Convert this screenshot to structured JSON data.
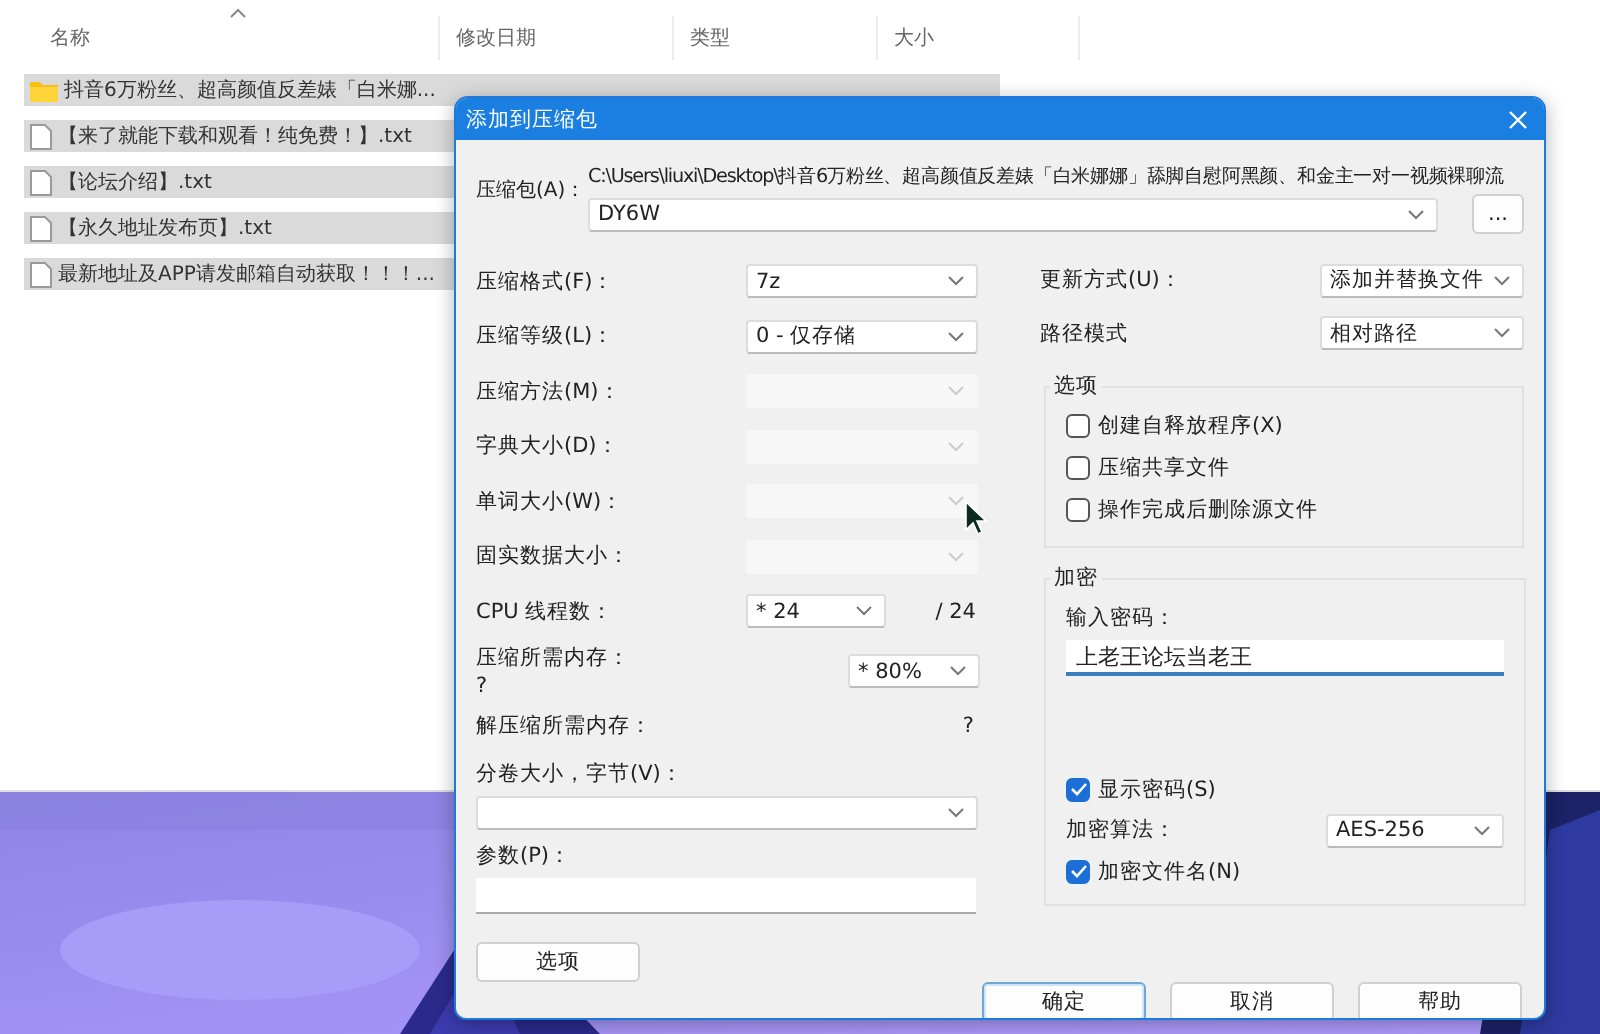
{
  "explorer": {
    "columns": [
      {
        "label": "名称",
        "sorted": true
      },
      {
        "label": "修改日期",
        "sorted": false
      },
      {
        "label": "类型",
        "sorted": false
      },
      {
        "label": "大小",
        "sorted": false
      }
    ],
    "rows": [
      {
        "kind": "folder",
        "name": "抖音6万粉丝、超高颜值反差婊「白米娜...",
        "selected": true
      },
      {
        "kind": "text-file",
        "name": "【来了就能下载和观看！纯免费！】.txt",
        "selected": true
      },
      {
        "kind": "text-file",
        "name": "【论坛介绍】.txt",
        "selected": true
      },
      {
        "kind": "text-file",
        "name": "【永久地址发布页】.txt",
        "selected": true
      },
      {
        "kind": "text-file",
        "name": "最新地址及APP请发邮箱自动获取！！！...",
        "selected": true
      }
    ]
  },
  "dialog": {
    "title": "添加到压缩包",
    "archive": {
      "label": "压缩包(A)：",
      "path": "C:\\Users\\liuxi\\Desktop\\抖音6万粉丝、超高颜值反差婊「白米娜娜」舔脚自慰阿黑颜、和金主一对一视频裸聊流",
      "value": "DY6W"
    },
    "browse_button": "...",
    "left_fields": [
      {
        "kind": "select",
        "label": "压缩格式(F)：",
        "value": "7z",
        "disabled": false
      },
      {
        "kind": "select",
        "label": "压缩等级(L)：",
        "value": "0 - 仅存储",
        "disabled": false
      },
      {
        "kind": "select",
        "label": "压缩方法(M)：",
        "disabled": true
      },
      {
        "kind": "select",
        "label": "字典大小(D)：",
        "disabled": true
      },
      {
        "kind": "select",
        "label": "单词大小(W)：",
        "disabled": true
      },
      {
        "kind": "select",
        "label": "固实数据大小：",
        "disabled": true
      },
      {
        "kind": "threads",
        "label": "CPU 线程数：",
        "value": "* 24",
        "suffix": "/ 24"
      },
      {
        "kind": "memory",
        "label": "压缩所需内存：",
        "note": "?",
        "value": "* 80%"
      },
      {
        "kind": "info",
        "label": "解压缩所需内存：",
        "note": "?"
      },
      {
        "kind": "stacked-select",
        "label": "分卷大小，字节(V)："
      },
      {
        "kind": "stacked-input",
        "label": "参数(P)："
      }
    ],
    "options_button": "选项",
    "right_fields": [
      {
        "label": "更新方式(U)：",
        "value": "添加并替换文件"
      },
      {
        "label": "路径模式",
        "value": "相对路径"
      }
    ],
    "options": {
      "title": "选项",
      "checkboxes": [
        {
          "label": "创建自释放程序(X)",
          "checked": false
        },
        {
          "label": "压缩共享文件",
          "checked": false
        },
        {
          "label": "操作完成后删除源文件",
          "checked": false
        }
      ]
    },
    "encryption": {
      "title": "加密",
      "password_label": "输入密码：",
      "password": "上老王论坛当老王",
      "show_password": {
        "label": "显示密码(S)",
        "checked": true
      },
      "algorithm_label": "加密算法：",
      "algorithm": "AES-256",
      "encrypt_names": {
        "label": "加密文件名(N)",
        "checked": true
      }
    },
    "buttons": [
      {
        "label": "确定",
        "default": true
      },
      {
        "label": "取消",
        "default": false
      },
      {
        "label": "帮助",
        "default": false
      }
    ]
  }
}
